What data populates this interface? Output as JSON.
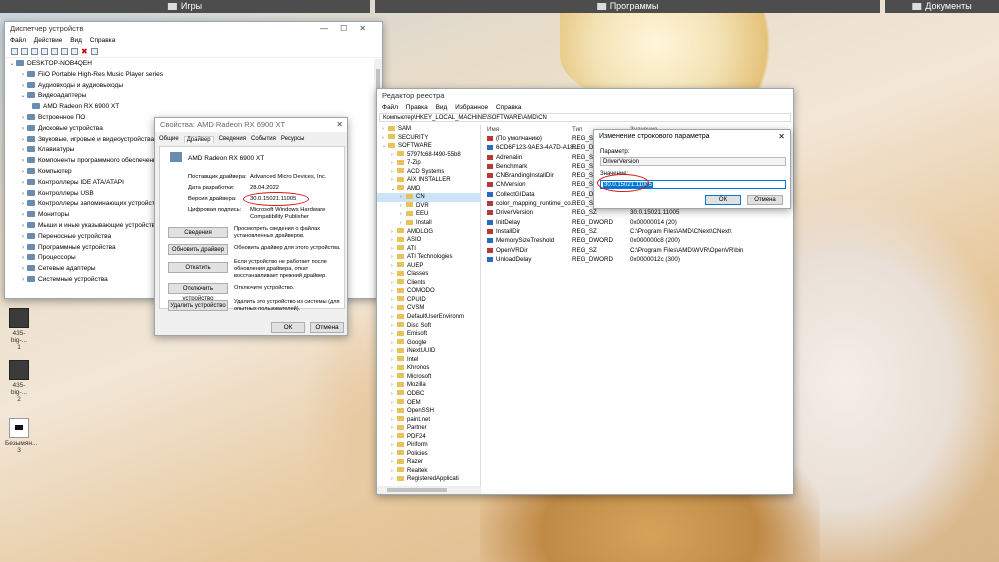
{
  "topbar": {
    "folders": [
      "Игры",
      "Программы",
      "Документы"
    ]
  },
  "desktop_icons": [
    {
      "label": "435-big-...",
      "sub": "1"
    },
    {
      "label": "435-big-...",
      "sub": "2"
    },
    {
      "label": "Безымян...",
      "sub": "3"
    }
  ],
  "device_manager": {
    "title": "Диспетчер устройств",
    "menu": [
      "Файл",
      "Действие",
      "Вид",
      "Справка"
    ],
    "root": "DESKTOP-NOB4QEH",
    "items": [
      {
        "label": "FiiO Portable High-Res Music Player series",
        "expanded": false
      },
      {
        "label": "Аудиовходы и аудиовыходы",
        "expanded": false
      },
      {
        "label": "Видеоадаптеры",
        "expanded": true
      },
      {
        "label": "AMD Radeon RX 6900 XT",
        "child": true
      },
      {
        "label": "Встроенное ПО",
        "expanded": false
      },
      {
        "label": "Дисковые устройства",
        "expanded": false
      },
      {
        "label": "Звуковые, игровые и видеоустройства",
        "expanded": false
      },
      {
        "label": "Клавиатуры",
        "expanded": false
      },
      {
        "label": "Компоненты программного обеспечения",
        "expanded": false
      },
      {
        "label": "Компьютер",
        "expanded": false
      },
      {
        "label": "Контроллеры IDE ATA/ATAPI",
        "expanded": false
      },
      {
        "label": "Контроллеры USB",
        "expanded": false
      },
      {
        "label": "Контроллеры запоминающих устройств",
        "expanded": false
      },
      {
        "label": "Мониторы",
        "expanded": false
      },
      {
        "label": "Мыши и иные указывающие устройства",
        "expanded": false
      },
      {
        "label": "Переносные устройства",
        "expanded": false
      },
      {
        "label": "Программные устройства",
        "expanded": false
      },
      {
        "label": "Процессоры",
        "expanded": false
      },
      {
        "label": "Сетевые адаптеры",
        "expanded": false
      },
      {
        "label": "Системные устройства",
        "expanded": false
      }
    ]
  },
  "properties": {
    "title": "Свойства: AMD Radeon RX 6900 XT",
    "tabs": [
      "Общие",
      "Драйвер",
      "Сведения",
      "События",
      "Ресурсы"
    ],
    "active_tab": "Драйвер",
    "device": "AMD Radeon RX 6900 XT",
    "fields": [
      {
        "k": "Поставщик драйвера:",
        "v": "Advanced Micro Devices, Inc."
      },
      {
        "k": "Дата разработки:",
        "v": "28.04.2022"
      },
      {
        "k": "Версия драйвера:",
        "v": "30.0.15021.11005"
      },
      {
        "k": "Цифровая подпись:",
        "v": "Microsoft Windows Hardware Compatibility Publisher"
      }
    ],
    "buttons": [
      {
        "label": "Сведения",
        "desc": "Просмотреть сведения о файлах установленных драйверов."
      },
      {
        "label": "Обновить драйвер",
        "desc": "Обновить драйвер для этого устройства."
      },
      {
        "label": "Откатить",
        "desc": "Если устройство не работает после обновления драйвера, откат восстанавливает прежний драйвер."
      },
      {
        "label": "Отключить устройство",
        "desc": "Отключите устройство."
      },
      {
        "label": "Удалить устройство",
        "desc": "Удалить это устройство из системы (для опытных пользователей)."
      }
    ],
    "ok": "ОК",
    "cancel": "Отмена"
  },
  "registry": {
    "title": "Редактор реестра",
    "menu": [
      "Файл",
      "Правка",
      "Вид",
      "Избранное",
      "Справка"
    ],
    "address": "Компьютер\\HKEY_LOCAL_MACHINE\\SOFTWARE\\AMD\\CN",
    "tree": [
      {
        "label": "SAM",
        "indent": 1
      },
      {
        "label": "SECURITY",
        "indent": 1
      },
      {
        "label": "SOFTWARE",
        "indent": 1,
        "exp": "v"
      },
      {
        "label": "5797fc68-f490-55b8",
        "indent": 2
      },
      {
        "label": "7-Zip",
        "indent": 2
      },
      {
        "label": "ACD Systems",
        "indent": 2
      },
      {
        "label": "AIX INSTALLER",
        "indent": 2
      },
      {
        "label": "AMD",
        "indent": 2,
        "exp": "v"
      },
      {
        "label": "CN",
        "indent": 3,
        "sel": true
      },
      {
        "label": "DVR",
        "indent": 3
      },
      {
        "label": "EEU",
        "indent": 3
      },
      {
        "label": "Install",
        "indent": 3
      },
      {
        "label": "AMDLOG",
        "indent": 2
      },
      {
        "label": "ASIO",
        "indent": 2
      },
      {
        "label": "ATI",
        "indent": 2
      },
      {
        "label": "ATI Technologies",
        "indent": 2
      },
      {
        "label": "AUEP",
        "indent": 2
      },
      {
        "label": "Classes",
        "indent": 2
      },
      {
        "label": "Clients",
        "indent": 2
      },
      {
        "label": "COMODO",
        "indent": 2
      },
      {
        "label": "CPUID",
        "indent": 2
      },
      {
        "label": "CVSM",
        "indent": 2
      },
      {
        "label": "DefaultUserEnvironm",
        "indent": 2
      },
      {
        "label": "Disc Soft",
        "indent": 2
      },
      {
        "label": "Emisoft",
        "indent": 2
      },
      {
        "label": "Google",
        "indent": 2
      },
      {
        "label": "iNextUUID",
        "indent": 2
      },
      {
        "label": "Intel",
        "indent": 2
      },
      {
        "label": "Khronos",
        "indent": 2
      },
      {
        "label": "Microsoft",
        "indent": 2
      },
      {
        "label": "Mozilla",
        "indent": 2
      },
      {
        "label": "ODBC",
        "indent": 2
      },
      {
        "label": "OEM",
        "indent": 2
      },
      {
        "label": "OpenSSH",
        "indent": 2
      },
      {
        "label": "paint.net",
        "indent": 2
      },
      {
        "label": "Partner",
        "indent": 2
      },
      {
        "label": "PDF24",
        "indent": 2
      },
      {
        "label": "Piriform",
        "indent": 2
      },
      {
        "label": "Policies",
        "indent": 2
      },
      {
        "label": "Razer",
        "indent": 2
      },
      {
        "label": "Realtek",
        "indent": 2
      },
      {
        "label": "RegisteredApplicati",
        "indent": 2
      }
    ],
    "columns": [
      "Имя",
      "Тип",
      "Значение"
    ],
    "values": [
      {
        "name": "(По умолчанию)",
        "type": "REG_SZ",
        "data": "",
        "bin": false
      },
      {
        "name": "6CD6F123-9AE3-4A7D-A18...",
        "type": "REG_DW",
        "data": "",
        "bin": true
      },
      {
        "name": "Adrenalin",
        "type": "REG_SZ",
        "data": "",
        "bin": false
      },
      {
        "name": "Benchmark",
        "type": "REG_SZ",
        "data": "",
        "bin": false
      },
      {
        "name": "CNBrandingInstallDir",
        "type": "REG_SZ",
        "data": "",
        "bin": false
      },
      {
        "name": "CNVersion",
        "type": "REG_SZ",
        "data": "",
        "bin": false
      },
      {
        "name": "CollectGIData",
        "type": "REG_DW",
        "data": "",
        "bin": true
      },
      {
        "name": "color_mapping_runtime_co...",
        "type": "REG_SZ",
        "data": "",
        "bin": false
      },
      {
        "name": "DriverVersion",
        "type": "REG_SZ",
        "data": "30.0.15021.11005",
        "bin": false
      },
      {
        "name": "InitDelay",
        "type": "REG_DWORD",
        "data": "0x00000014 (20)",
        "bin": true
      },
      {
        "name": "InstallDir",
        "type": "REG_SZ",
        "data": "C:\\Program Files\\AMD\\CNext\\CNext\\",
        "bin": false
      },
      {
        "name": "MemorySizeTreshold",
        "type": "REG_DWORD",
        "data": "0x000000c8 (200)",
        "bin": true
      },
      {
        "name": "OpenVRDir",
        "type": "REG_SZ",
        "data": "C:\\Program Files\\AMD\\WVR\\OpenVR\\bin",
        "bin": false
      },
      {
        "name": "UnloadDelay",
        "type": "REG_DWORD",
        "data": "0x0000012c (300)",
        "bin": true
      }
    ]
  },
  "edit_dialog": {
    "title": "Изменение строкового параметра",
    "param_label": "Параметр:",
    "param_value": "DriverVersion",
    "value_label": "Значение:",
    "value": "30.0.15021.11005",
    "ok": "ОК",
    "cancel": "Отмена"
  }
}
